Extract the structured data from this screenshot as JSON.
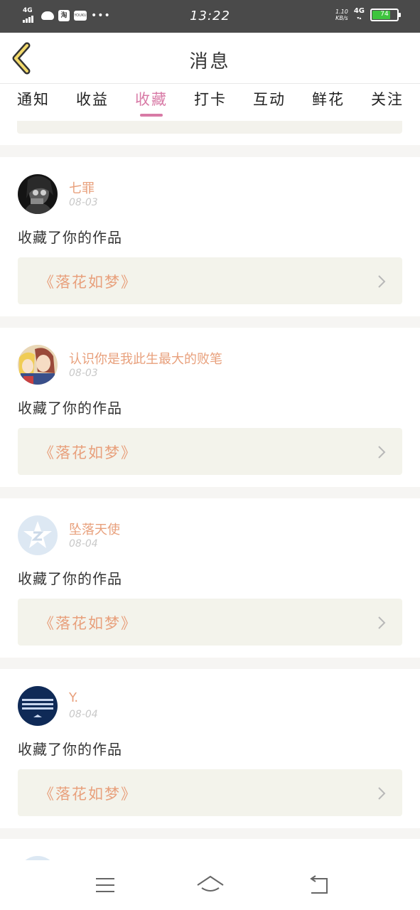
{
  "status_bar": {
    "network_left": "4G",
    "taobao_label": "淘",
    "youku_label": "YOUKU",
    "more": "•••",
    "time": "13:22",
    "speed_value": "1.10",
    "speed_unit": "KB/s",
    "network_right": "4G",
    "battery_level": "74"
  },
  "header": {
    "title": "消息"
  },
  "tabs": [
    {
      "label": "通知",
      "active": false
    },
    {
      "label": "收益",
      "active": false
    },
    {
      "label": "收藏",
      "active": true
    },
    {
      "label": "打卡",
      "active": false
    },
    {
      "label": "互动",
      "active": false
    },
    {
      "label": "鲜花",
      "active": false
    },
    {
      "label": "关注",
      "active": false
    }
  ],
  "messages": [
    {
      "username": "七罪",
      "date": "08-03",
      "action": "收藏了你的作品",
      "work_title": "《落花如梦》",
      "avatar": "dark-portrait"
    },
    {
      "username": "认识你是我此生最大的败笔",
      "date": "08-03",
      "action": "收藏了你的作品",
      "work_title": "《落花如梦》",
      "avatar": "anime-portrait"
    },
    {
      "username": "坠落天使",
      "date": "08-04",
      "action": "收藏了你的作品",
      "work_title": "《落花如梦》",
      "avatar": "default-star"
    },
    {
      "username": "Y.",
      "date": "08-04",
      "action": "收藏了你的作品",
      "work_title": "《落花如梦》",
      "avatar": "blue-stripes"
    }
  ],
  "colors": {
    "accent": "#d87aa6",
    "username": "#e8a07c",
    "work_link_bg": "#f3f3eb",
    "status_bar_bg": "#4a4a4a",
    "battery": "#3ec43e"
  }
}
